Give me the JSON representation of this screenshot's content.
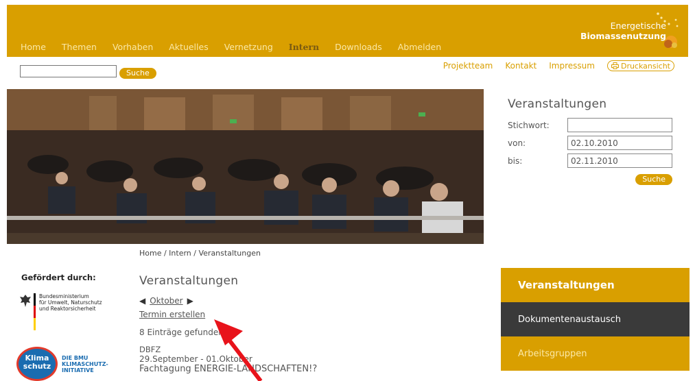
{
  "nav": {
    "items": [
      {
        "label": "Home"
      },
      {
        "label": "Themen"
      },
      {
        "label": "Vorhaben"
      },
      {
        "label": "Aktuelles"
      },
      {
        "label": "Vernetzung"
      },
      {
        "label": "Intern",
        "active": true
      },
      {
        "label": "Downloads"
      },
      {
        "label": "Abmelden"
      }
    ]
  },
  "logo": {
    "line1": "Energetische",
    "line2": "Biomassenutzung"
  },
  "search": {
    "value": "",
    "button": "Suche"
  },
  "utility": {
    "links": [
      "Projektteam",
      "Kontakt",
      "Impressum"
    ],
    "print": "Druckansicht"
  },
  "breadcrumb": "Home / Intern / Veranstaltungen",
  "funding": {
    "title": "Gefördert durch:",
    "bmu": [
      "Bundesministerium",
      "für Umwelt, Naturschutz",
      "und Reaktorsicherheit"
    ],
    "klima_badge": [
      "Klima",
      "schutz"
    ],
    "klima_text": [
      "DIE BMU",
      "KLIMASCHUTZ-",
      "INITIATIVE"
    ]
  },
  "main": {
    "title": "Veranstaltungen",
    "month": "Oktober",
    "create_link": "Termin erstellen",
    "count": "8 Einträge gefunden",
    "entry": {
      "org": "DBFZ",
      "date": "29.September - 01.Oktober",
      "title": "Fachtagung ENERGIE-LANDSCHAFTEN!?"
    }
  },
  "sidebar_search": {
    "title": "Veranstaltungen",
    "keyword_label": "Stichwort:",
    "keyword_value": "",
    "from_label": "von:",
    "from_value": "02.10.2010",
    "to_label": "bis:",
    "to_value": "02.11.2010",
    "button": "Suche"
  },
  "side_menu": [
    {
      "label": "Veranstaltungen",
      "style": "active"
    },
    {
      "label": "Dokumentenaustausch",
      "style": "dark"
    },
    {
      "label": "Arbeitsgruppen",
      "style": "gold"
    }
  ],
  "colors": {
    "brand": "#d99f00",
    "dark_menu": "#3a3a3a",
    "annotation_arrow": "#e8131b"
  }
}
